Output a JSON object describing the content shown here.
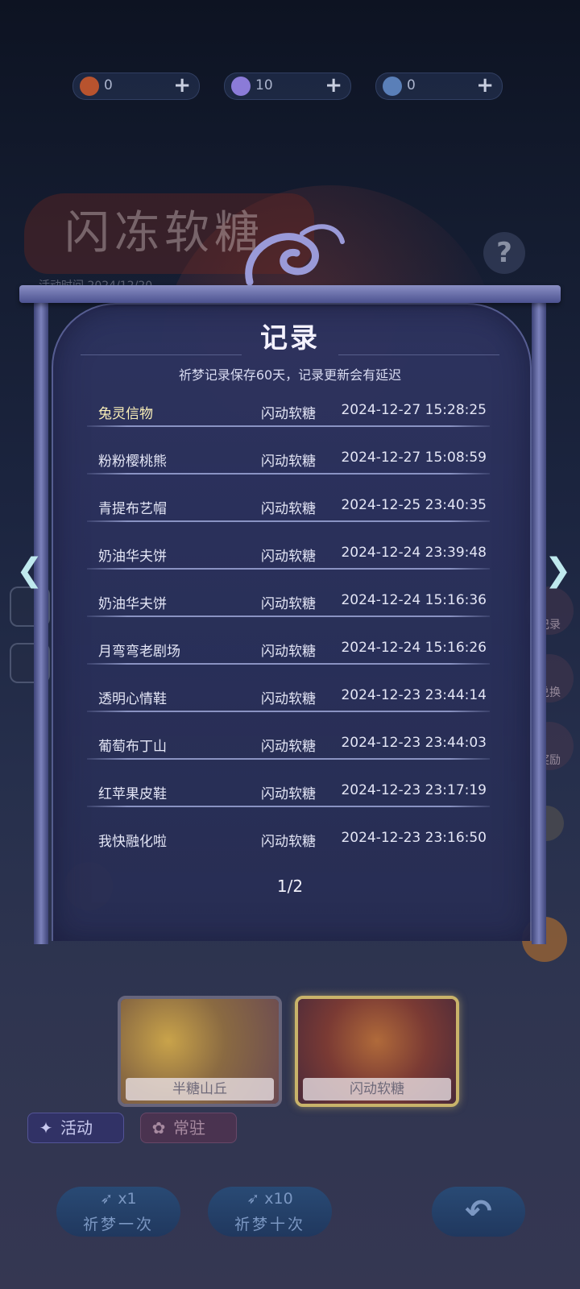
{
  "currencies": [
    {
      "icon": "flower-coin-icon",
      "value": "0",
      "color": "#b8532e"
    },
    {
      "icon": "moon-coin-icon",
      "value": "10",
      "color": "#8b7bd8"
    },
    {
      "icon": "feather-coin-icon",
      "value": "0",
      "color": "#5a7fb8"
    }
  ],
  "background": {
    "event_title": "闪冻软糖",
    "event_time": "活动时间 2024/12/20",
    "help_label": "?",
    "right_buttons": [
      "记录",
      "兑换",
      "奖励"
    ]
  },
  "panel": {
    "title": "记录",
    "subtitle": "祈梦记录保存60天，记录更新会有延迟",
    "records": [
      {
        "item": "兔灵信物",
        "pool": "闪动软糖",
        "time": "2024-12-27 15:28:25",
        "highlight": true
      },
      {
        "item": "粉粉樱桃熊",
        "pool": "闪动软糖",
        "time": "2024-12-27 15:08:59",
        "highlight": false
      },
      {
        "item": "青提布艺帽",
        "pool": "闪动软糖",
        "time": "2024-12-25 23:40:35",
        "highlight": false
      },
      {
        "item": "奶油华夫饼",
        "pool": "闪动软糖",
        "time": "2024-12-24 23:39:48",
        "highlight": false
      },
      {
        "item": "奶油华夫饼",
        "pool": "闪动软糖",
        "time": "2024-12-24 15:16:36",
        "highlight": false
      },
      {
        "item": "月弯弯老剧场",
        "pool": "闪动软糖",
        "time": "2024-12-24 15:16:26",
        "highlight": false
      },
      {
        "item": "透明心情鞋",
        "pool": "闪动软糖",
        "time": "2024-12-23 23:44:14",
        "highlight": false
      },
      {
        "item": "葡萄布丁山",
        "pool": "闪动软糖",
        "time": "2024-12-23 23:44:03",
        "highlight": false
      },
      {
        "item": "红苹果皮鞋",
        "pool": "闪动软糖",
        "time": "2024-12-23 23:17:19",
        "highlight": false
      },
      {
        "item": "我快融化啦",
        "pool": "闪动软糖",
        "time": "2024-12-23 23:16:50",
        "highlight": false
      }
    ],
    "page": "1/2",
    "prev_arrow": "❮",
    "next_arrow": "❯"
  },
  "pools": [
    {
      "label": "半糖山丘",
      "selected": false
    },
    {
      "label": "闪动软糖",
      "selected": true
    }
  ],
  "tabs": [
    {
      "label": "活动",
      "icon": "party-popper-icon"
    },
    {
      "label": "常驻",
      "icon": "swirl-icon"
    }
  ],
  "buttons": {
    "draw_once_count": "x1",
    "draw_once_label": "祈梦一次",
    "draw_ten_count": "x10",
    "draw_ten_label": "祈梦十次",
    "back_icon": "return-arrow-icon"
  }
}
